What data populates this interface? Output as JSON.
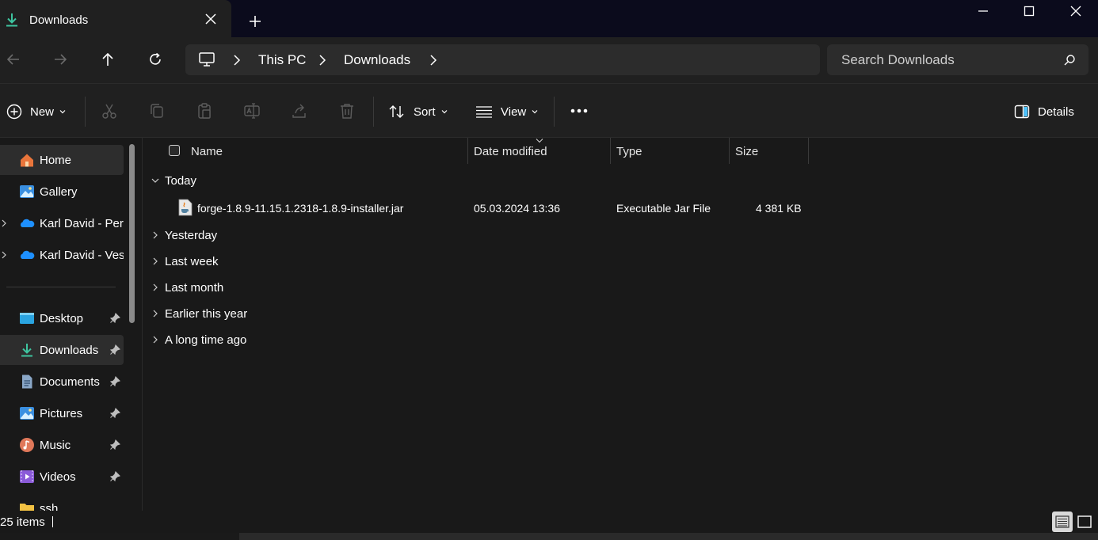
{
  "tab": {
    "title": "Downloads"
  },
  "breadcrumb": {
    "items": [
      "This PC",
      "Downloads"
    ]
  },
  "search": {
    "placeholder": "Search Downloads"
  },
  "toolbar": {
    "new_label": "New",
    "sort_label": "Sort",
    "view_label": "View",
    "details_label": "Details"
  },
  "sidebar": {
    "items": [
      {
        "label": "Home",
        "icon": "home-icon"
      },
      {
        "label": "Gallery",
        "icon": "gallery-icon"
      },
      {
        "label": "Karl David - Pers",
        "icon": "onedrive-icon"
      },
      {
        "label": "Karl David - Ves",
        "icon": "onedrive-icon"
      },
      {
        "label": "Desktop",
        "icon": "desktop-icon"
      },
      {
        "label": "Downloads",
        "icon": "download-icon"
      },
      {
        "label": "Documents",
        "icon": "documents-icon"
      },
      {
        "label": "Pictures",
        "icon": "pictures-icon"
      },
      {
        "label": "Music",
        "icon": "music-icon"
      },
      {
        "label": "Videos",
        "icon": "videos-icon"
      },
      {
        "label": "ssh",
        "icon": "folder-icon"
      }
    ]
  },
  "columns": {
    "name": "Name",
    "date": "Date modified",
    "type": "Type",
    "size": "Size"
  },
  "groups": {
    "today": "Today",
    "yesterday": "Yesterday",
    "last_week": "Last week",
    "last_month": "Last month",
    "earlier_year": "Earlier this year",
    "long_ago": "A long time ago"
  },
  "files": [
    {
      "name": "forge-1.8.9-11.15.1.2318-1.8.9-installer.jar",
      "date": "05.03.2024 13:36",
      "type": "Executable Jar File",
      "size": "4 381 KB"
    }
  ],
  "status": {
    "count": "25 items"
  },
  "colors": {
    "accent": "#4cc2ff",
    "download_green": "#3ec5a0",
    "background": "#191919"
  }
}
